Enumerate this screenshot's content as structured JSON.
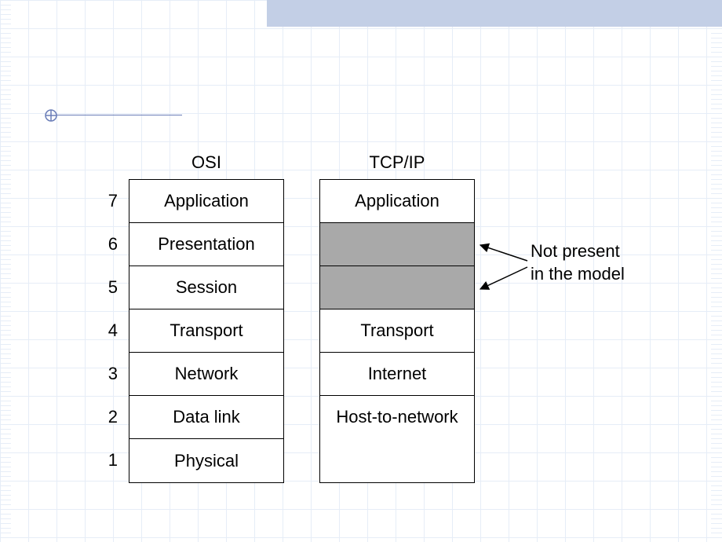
{
  "headers": {
    "osi": "OSI",
    "tcpip": "TCP/IP"
  },
  "numbers": [
    "7",
    "6",
    "5",
    "4",
    "3",
    "2",
    "1"
  ],
  "osi_layers": [
    "Application",
    "Presentation",
    "Session",
    "Transport",
    "Network",
    "Data link",
    "Physical"
  ],
  "tcpip_layers": {
    "application": "Application",
    "transport": "Transport",
    "internet": "Internet",
    "host": "Host-to-network"
  },
  "annotation": {
    "line1": "Not present",
    "line2": "in the model"
  }
}
